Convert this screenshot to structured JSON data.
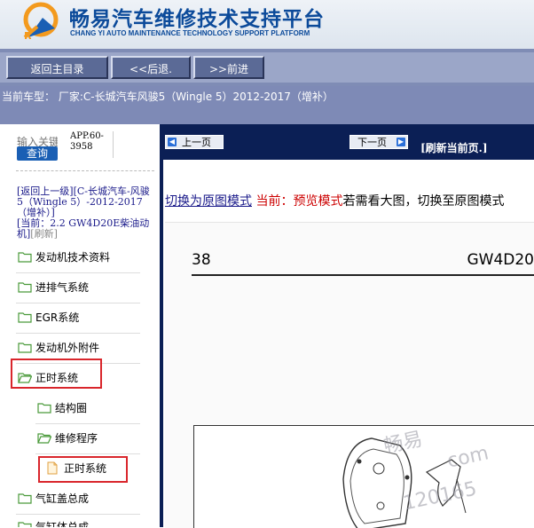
{
  "header": {
    "title": "畅易汽车维修技术支持平台",
    "subtitle": "CHANG YI AUTO MAINTENANCE TECHNOLOGY SUPPORT PLATFORM",
    "brand_color": "#0b4a9a"
  },
  "toolbar": {
    "home_label": "返回主目录",
    "back_label": "<<后退.",
    "forward_label": ">>前进"
  },
  "model_bar": {
    "text": "当前车型：  厂家:C-长城汽车风骏5（Wingle 5）2012-2017（增补）"
  },
  "sidebar": {
    "search_placeholder": "输入关键",
    "search_button": "查询",
    "app_id": "APP.60-3958",
    "nav": {
      "back_up": "[返回上一级]",
      "parent": "[C-长城汽车-风骏5（Wingle 5）-2012-2017（增补）]",
      "current": "[当前：2.2 GW4D20E柴油动机]",
      "refresh": "[刷新]"
    },
    "items": [
      {
        "label": "发动机技术资料",
        "icon": "folder-icon"
      },
      {
        "label": "进排气系统",
        "icon": "folder-icon"
      },
      {
        "label": "EGR系统",
        "icon": "folder-icon"
      },
      {
        "label": "发动机外附件",
        "icon": "folder-icon"
      },
      {
        "label": "正时系统",
        "icon": "folder-open-icon"
      },
      {
        "label": "结构圈",
        "icon": "folder-icon"
      },
      {
        "label": "维修程序",
        "icon": "folder-open-icon"
      },
      {
        "label": "正时系统",
        "icon": "document-icon"
      },
      {
        "label": "气缸盖总成",
        "icon": "folder-icon"
      },
      {
        "label": "气缸体总成",
        "icon": "folder-icon"
      }
    ],
    "highlight_color": "#d9262c"
  },
  "content": {
    "prev_label": "上一页",
    "next_label": "下一页",
    "refresh_label": "[刷新当前页.]",
    "mode_link": "切换为原图模式",
    "mode_current": " 当前：预览模式",
    "mode_hint": "若需看大图，切换至原图模式",
    "page_number": "38",
    "page_code": "GW4D20",
    "watermark_1": "畅易",
    "watermark_2": "com",
    "watermark_3": "120165"
  }
}
